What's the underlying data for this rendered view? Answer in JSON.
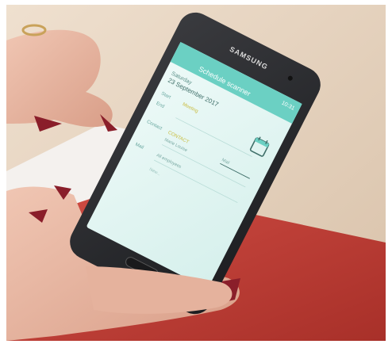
{
  "phone": {
    "brand": "SAMSUNG",
    "status_time": "10:31",
    "app_title": "Schedule scanner",
    "date_label": "Saturday",
    "date_value": "23 September 2017",
    "row_labels": [
      "Start",
      "End",
      "Contact",
      "Mail"
    ],
    "event_title": "Meeting",
    "contact_value": "CONTACT",
    "contact_fields": [
      "Marie Louise",
      "Mail"
    ],
    "mail_value": "All employees",
    "input_placeholder": "New..."
  },
  "colors": {
    "background_wall": "#e3d2bf",
    "table_red": "#c9423b",
    "phone_body": "#2a2b2e",
    "screen_bg": "#e8f7f5",
    "app_header": "#6bd0c3",
    "accent_yellow": "#e2d55a",
    "nail_polish": "#8a1e2a",
    "skin": "#e9b8a3"
  }
}
